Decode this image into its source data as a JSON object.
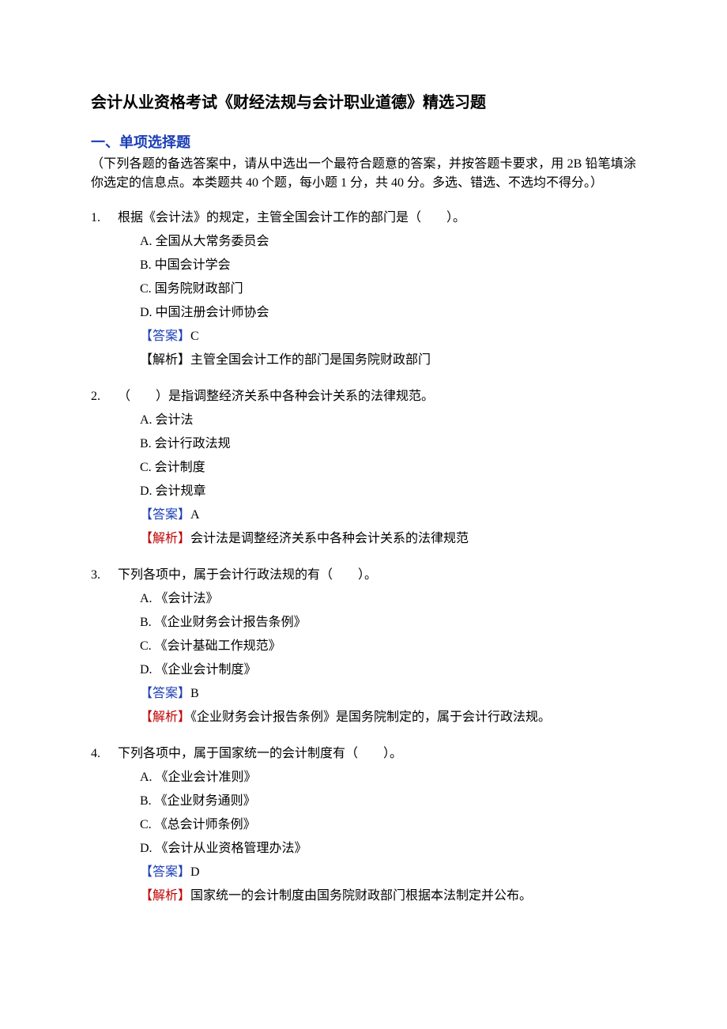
{
  "title": "会计从业资格考试《财经法规与会计职业道德》精选习题",
  "section": {
    "heading": "一、单项选择题",
    "instructions": "（下列各题的备选答案中，请从中选出一个最符合题意的答案，并按答题卡要求，用 2B 铅笔填涂你选定的信息点。本类题共 40 个题，每小题 1 分，共 40 分。多选、错选、不选均不得分。）"
  },
  "labels": {
    "answer": "【答案】",
    "explain": "【解析】"
  },
  "questions": [
    {
      "num": "1.",
      "stem": "根据《会计法》的规定，主管全国会计工作的部门是（　　）。",
      "options": [
        "A. 全国从大常务委员会",
        "B. 中国会计学会",
        "C. 国务院财政部门",
        "D. 中国注册会计师协会"
      ],
      "answer": "C",
      "explain_label_color": "black",
      "explain": "主管全国会计工作的部门是国务院财政部门"
    },
    {
      "num": "2.",
      "stem": "（　　）是指调整经济关系中各种会计关系的法律规范。",
      "options": [
        "A. 会计法",
        "B. 会计行政法规",
        "C. 会计制度",
        "D. 会计规章"
      ],
      "answer": "A",
      "explain_label_color": "red",
      "explain": "会计法是调整经济关系中各种会计关系的法律规范"
    },
    {
      "num": "3.",
      "stem": "下列各项中，属于会计行政法规的有（　　）。",
      "options": [
        "A. 《会计法》",
        "B. 《企业财务会计报告条例》",
        "C. 《会计基础工作规范》",
        "D. 《企业会计制度》"
      ],
      "answer": "B",
      "explain_label_color": "red",
      "explain": "《企业财务会计报告条例》是国务院制定的，属于会计行政法规。"
    },
    {
      "num": "4.",
      "stem": "下列各项中，属于国家统一的会计制度有（　　）。",
      "options": [
        "A. 《企业会计准则》",
        "B. 《企业财务通则》",
        "C. 《总会计师条例》",
        "D. 《会计从业资格管理办法》"
      ],
      "answer": "D",
      "explain_label_color": "red",
      "explain": "国家统一的会计制度由国务院财政部门根据本法制定并公布。"
    }
  ]
}
